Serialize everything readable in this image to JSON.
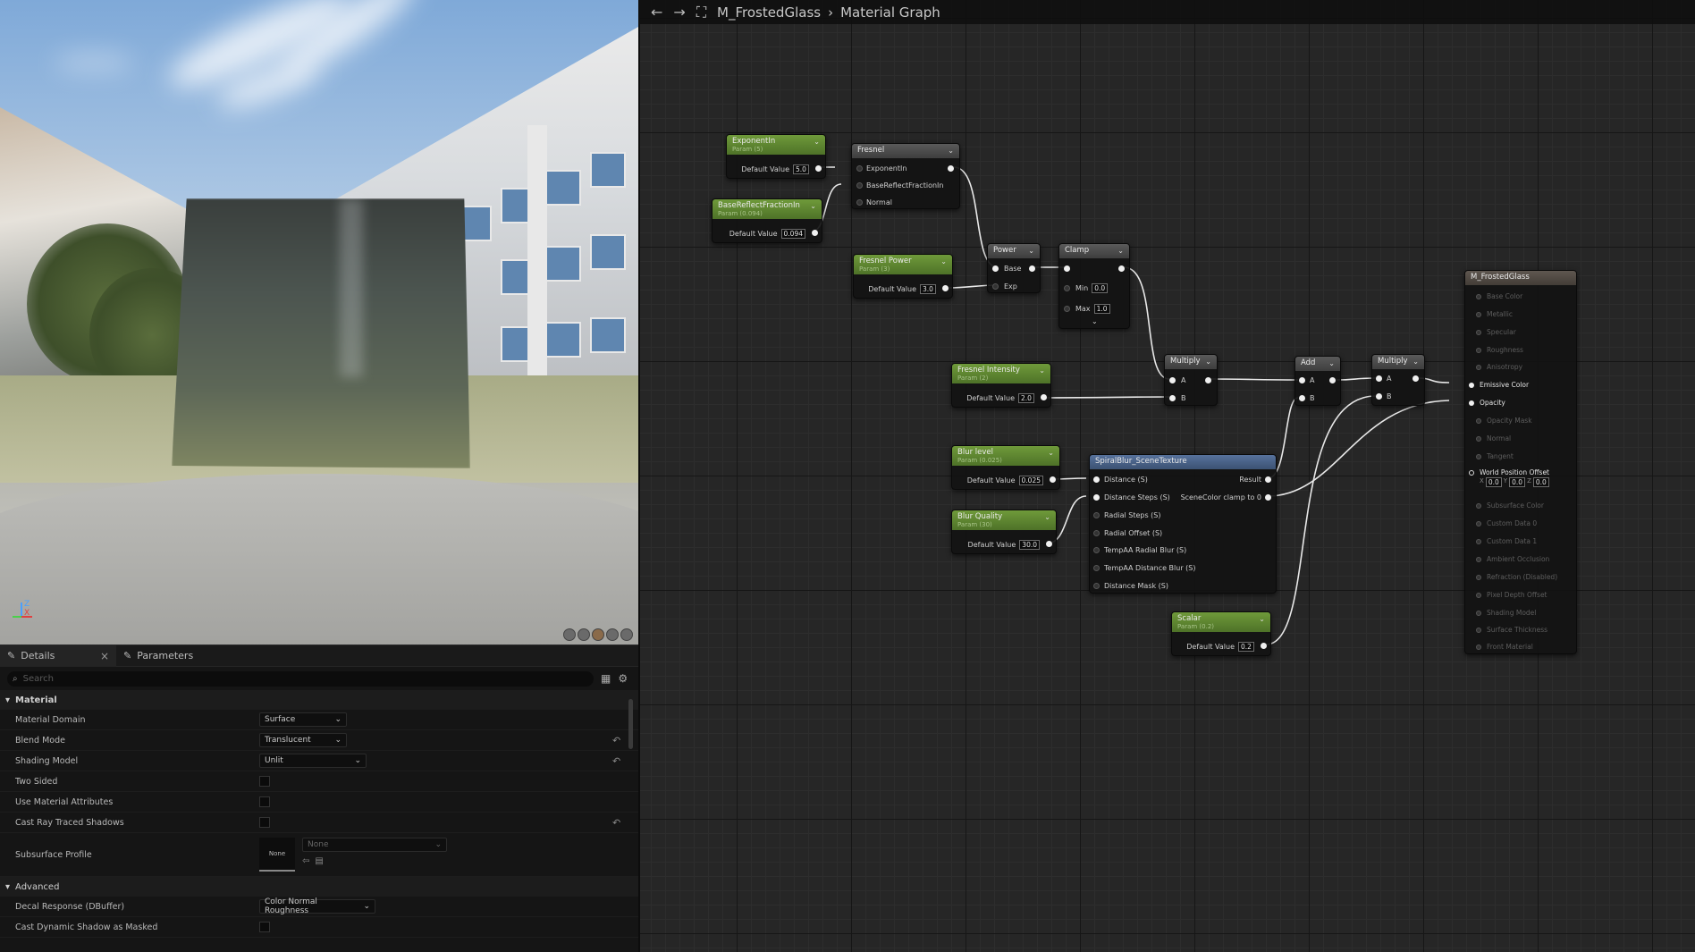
{
  "graph_header": {
    "asset_name": "M_FrostedGlass",
    "separator": "›",
    "graph_name": "Material Graph"
  },
  "details": {
    "tabs": [
      {
        "label": "Details"
      },
      {
        "label": "Parameters"
      }
    ],
    "search_placeholder": "Search",
    "sections": {
      "material": "Material",
      "advanced": "Advanced"
    },
    "properties": {
      "material_domain": {
        "label": "Material Domain",
        "value": "Surface"
      },
      "blend_mode": {
        "label": "Blend Mode",
        "value": "Translucent"
      },
      "shading_model": {
        "label": "Shading Model",
        "value": "Unlit"
      },
      "two_sided": {
        "label": "Two Sided",
        "checked": false
      },
      "use_material_attributes": {
        "label": "Use Material Attributes",
        "checked": false
      },
      "cast_ray_traced_shadows": {
        "label": "Cast Ray Traced Shadows",
        "checked": false
      },
      "subsurface_profile": {
        "label": "Subsurface Profile",
        "thumb": "None",
        "value": "None"
      },
      "decal_response": {
        "label": "Decal Response (DBuffer)",
        "value": "Color Normal Roughness"
      },
      "cast_dynamic_shadow_as_masked": {
        "label": "Cast Dynamic Shadow as Masked",
        "checked": false
      }
    }
  },
  "nodes": {
    "exponentin": {
      "title": "ExponentIn",
      "sub": "Param (5)",
      "default_label": "Default Value",
      "value": "5.0"
    },
    "basereflect": {
      "title": "BaseReflectFractionIn",
      "sub": "Param (0.094)",
      "default_label": "Default Value",
      "value": "0.094"
    },
    "fresnel": {
      "title": "Fresnel",
      "pins": [
        "ExponentIn",
        "BaseReflectFractionIn",
        "Normal"
      ]
    },
    "fresnel_power": {
      "title": "Fresnel Power",
      "sub": "Param (3)",
      "default_label": "Default Value",
      "value": "3.0"
    },
    "power": {
      "title": "Power",
      "pins": [
        "Base",
        "Exp"
      ]
    },
    "clamp": {
      "title": "Clamp",
      "min_label": "Min",
      "min": "0.0",
      "max_label": "Max",
      "max": "1.0"
    },
    "fresnel_intensity": {
      "title": "Fresnel Intensity",
      "sub": "Param (2)",
      "default_label": "Default Value",
      "value": "2.0"
    },
    "multiply1": {
      "title": "Multiply",
      "pins": [
        "A",
        "B"
      ]
    },
    "add": {
      "title": "Add",
      "pins": [
        "A",
        "B"
      ]
    },
    "multiply2": {
      "title": "Multiply",
      "pins": [
        "A",
        "B"
      ]
    },
    "blur_level": {
      "title": "Blur level",
      "sub": "Param (0.025)",
      "default_label": "Default Value",
      "value": "0.025"
    },
    "blur_quality": {
      "title": "Blur Quality",
      "sub": "Param (30)",
      "default_label": "Default Value",
      "value": "30.0"
    },
    "spiralblur": {
      "title": "SpiralBlur_SceneTexture",
      "inputs": [
        "Distance (S)",
        "Distance Steps (S)",
        "Radial Steps (S)",
        "Radial Offset (S)",
        "TempAA Radial Blur (S)",
        "TempAA Distance Blur (S)",
        "Distance Mask (S)"
      ],
      "outputs": [
        "Result",
        "SceneColor clamp to 0"
      ]
    },
    "scalar": {
      "title": "Scalar",
      "sub": "Param (0.2)",
      "default_label": "Default Value",
      "value": "0.2"
    },
    "result": {
      "title": "M_FrostedGlass",
      "pins": [
        "Base Color",
        "Metallic",
        "Specular",
        "Roughness",
        "Anisotropy",
        "Emissive Color",
        "Opacity",
        "Opacity Mask",
        "Normal",
        "Tangent",
        "World Position Offset",
        "Subsurface Color",
        "Custom Data 0",
        "Custom Data 1",
        "Ambient Occlusion",
        "Refraction (Disabled)",
        "Pixel Depth Offset",
        "Shading Model",
        "Surface Thickness",
        "Front Material"
      ],
      "wpo": {
        "x": "0.0",
        "y": "0.0",
        "z": "0.0"
      }
    }
  },
  "viewport": {
    "axis_labels": {
      "z": "Z",
      "x": "X"
    }
  }
}
